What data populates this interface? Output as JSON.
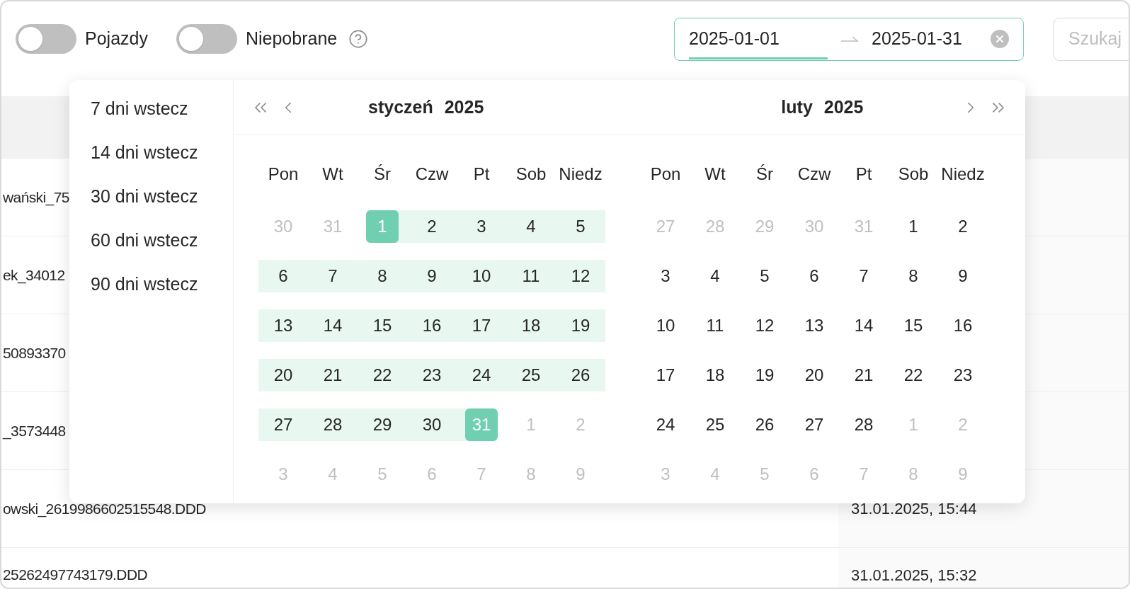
{
  "toggles": [
    {
      "label": "Pojazdy",
      "on": false,
      "help": false
    },
    {
      "label": "Niepobrane",
      "on": false,
      "help": true
    }
  ],
  "date_range": {
    "start": "2025-01-01",
    "end": "2025-01-31",
    "start_active": true
  },
  "search": {
    "placeholder": "Szukaj"
  },
  "table": {
    "rows": [
      {
        "file": "wański_75"
      },
      {
        "file": "ek_34012"
      },
      {
        "file": "50893370"
      },
      {
        "file": "_3573448"
      },
      {
        "file": "owski_2619986602515548.DDD",
        "date": "31.01.2025, 15:44"
      },
      {
        "file": "25262497743179.DDD",
        "date": "31.01.2025, 15:32"
      }
    ]
  },
  "picker": {
    "presets": [
      "7 dni wstecz",
      "14 dni wstecz",
      "30 dni wstecz",
      "60 dni wstecz",
      "90 dni wstecz"
    ],
    "months": [
      {
        "month": "styczeń",
        "year": "2025",
        "weekdays": [
          "Pon",
          "Wt",
          "Śr",
          "Czw",
          "Pt",
          "Sob",
          "Niedz"
        ],
        "weeks": [
          [
            {
              "d": "30",
              "muted": true,
              "in_range": false,
              "selected": false
            },
            {
              "d": "31",
              "muted": true,
              "in_range": false,
              "selected": false
            },
            {
              "d": "1",
              "muted": false,
              "in_range": true,
              "selected": true
            },
            {
              "d": "2",
              "muted": false,
              "in_range": true,
              "selected": false
            },
            {
              "d": "3",
              "muted": false,
              "in_range": true,
              "selected": false
            },
            {
              "d": "4",
              "muted": false,
              "in_range": true,
              "selected": false
            },
            {
              "d": "5",
              "muted": false,
              "in_range": true,
              "selected": false
            }
          ],
          [
            {
              "d": "6",
              "muted": false,
              "in_range": true,
              "selected": false
            },
            {
              "d": "7",
              "muted": false,
              "in_range": true,
              "selected": false
            },
            {
              "d": "8",
              "muted": false,
              "in_range": true,
              "selected": false
            },
            {
              "d": "9",
              "muted": false,
              "in_range": true,
              "selected": false
            },
            {
              "d": "10",
              "muted": false,
              "in_range": true,
              "selected": false
            },
            {
              "d": "11",
              "muted": false,
              "in_range": true,
              "selected": false
            },
            {
              "d": "12",
              "muted": false,
              "in_range": true,
              "selected": false
            }
          ],
          [
            {
              "d": "13",
              "muted": false,
              "in_range": true,
              "selected": false
            },
            {
              "d": "14",
              "muted": false,
              "in_range": true,
              "selected": false
            },
            {
              "d": "15",
              "muted": false,
              "in_range": true,
              "selected": false
            },
            {
              "d": "16",
              "muted": false,
              "in_range": true,
              "selected": false
            },
            {
              "d": "17",
              "muted": false,
              "in_range": true,
              "selected": false
            },
            {
              "d": "18",
              "muted": false,
              "in_range": true,
              "selected": false
            },
            {
              "d": "19",
              "muted": false,
              "in_range": true,
              "selected": false
            }
          ],
          [
            {
              "d": "20",
              "muted": false,
              "in_range": true,
              "selected": false
            },
            {
              "d": "21",
              "muted": false,
              "in_range": true,
              "selected": false
            },
            {
              "d": "22",
              "muted": false,
              "in_range": true,
              "selected": false
            },
            {
              "d": "23",
              "muted": false,
              "in_range": true,
              "selected": false
            },
            {
              "d": "24",
              "muted": false,
              "in_range": true,
              "selected": false
            },
            {
              "d": "25",
              "muted": false,
              "in_range": true,
              "selected": false
            },
            {
              "d": "26",
              "muted": false,
              "in_range": true,
              "selected": false
            }
          ],
          [
            {
              "d": "27",
              "muted": false,
              "in_range": true,
              "selected": false
            },
            {
              "d": "28",
              "muted": false,
              "in_range": true,
              "selected": false
            },
            {
              "d": "29",
              "muted": false,
              "in_range": true,
              "selected": false
            },
            {
              "d": "30",
              "muted": false,
              "in_range": true,
              "selected": false
            },
            {
              "d": "31",
              "muted": false,
              "in_range": true,
              "selected": true
            },
            {
              "d": "1",
              "muted": true,
              "in_range": false,
              "selected": false
            },
            {
              "d": "2",
              "muted": true,
              "in_range": false,
              "selected": false
            }
          ],
          [
            {
              "d": "3",
              "muted": true,
              "in_range": false,
              "selected": false
            },
            {
              "d": "4",
              "muted": true,
              "in_range": false,
              "selected": false
            },
            {
              "d": "5",
              "muted": true,
              "in_range": false,
              "selected": false
            },
            {
              "d": "6",
              "muted": true,
              "in_range": false,
              "selected": false
            },
            {
              "d": "7",
              "muted": true,
              "in_range": false,
              "selected": false
            },
            {
              "d": "8",
              "muted": true,
              "in_range": false,
              "selected": false
            },
            {
              "d": "9",
              "muted": true,
              "in_range": false,
              "selected": false
            }
          ]
        ]
      },
      {
        "month": "luty",
        "year": "2025",
        "weekdays": [
          "Pon",
          "Wt",
          "Śr",
          "Czw",
          "Pt",
          "Sob",
          "Niedz"
        ],
        "weeks": [
          [
            {
              "d": "27",
              "muted": true,
              "in_range": false,
              "selected": false
            },
            {
              "d": "28",
              "muted": true,
              "in_range": false,
              "selected": false
            },
            {
              "d": "29",
              "muted": true,
              "in_range": false,
              "selected": false
            },
            {
              "d": "30",
              "muted": true,
              "in_range": false,
              "selected": false
            },
            {
              "d": "31",
              "muted": true,
              "in_range": false,
              "selected": false
            },
            {
              "d": "1",
              "muted": false,
              "in_range": false,
              "selected": false
            },
            {
              "d": "2",
              "muted": false,
              "in_range": false,
              "selected": false
            }
          ],
          [
            {
              "d": "3",
              "muted": false,
              "in_range": false,
              "selected": false
            },
            {
              "d": "4",
              "muted": false,
              "in_range": false,
              "selected": false
            },
            {
              "d": "5",
              "muted": false,
              "in_range": false,
              "selected": false
            },
            {
              "d": "6",
              "muted": false,
              "in_range": false,
              "selected": false
            },
            {
              "d": "7",
              "muted": false,
              "in_range": false,
              "selected": false
            },
            {
              "d": "8",
              "muted": false,
              "in_range": false,
              "selected": false
            },
            {
              "d": "9",
              "muted": false,
              "in_range": false,
              "selected": false
            }
          ],
          [
            {
              "d": "10",
              "muted": false,
              "in_range": false,
              "selected": false
            },
            {
              "d": "11",
              "muted": false,
              "in_range": false,
              "selected": false
            },
            {
              "d": "12",
              "muted": false,
              "in_range": false,
              "selected": false
            },
            {
              "d": "13",
              "muted": false,
              "in_range": false,
              "selected": false
            },
            {
              "d": "14",
              "muted": false,
              "in_range": false,
              "selected": false
            },
            {
              "d": "15",
              "muted": false,
              "in_range": false,
              "selected": false
            },
            {
              "d": "16",
              "muted": false,
              "in_range": false,
              "selected": false
            }
          ],
          [
            {
              "d": "17",
              "muted": false,
              "in_range": false,
              "selected": false
            },
            {
              "d": "18",
              "muted": false,
              "in_range": false,
              "selected": false
            },
            {
              "d": "19",
              "muted": false,
              "in_range": false,
              "selected": false
            },
            {
              "d": "20",
              "muted": false,
              "in_range": false,
              "selected": false
            },
            {
              "d": "21",
              "muted": false,
              "in_range": false,
              "selected": false
            },
            {
              "d": "22",
              "muted": false,
              "in_range": false,
              "selected": false
            },
            {
              "d": "23",
              "muted": false,
              "in_range": false,
              "selected": false
            }
          ],
          [
            {
              "d": "24",
              "muted": false,
              "in_range": false,
              "selected": false
            },
            {
              "d": "25",
              "muted": false,
              "in_range": false,
              "selected": false
            },
            {
              "d": "26",
              "muted": false,
              "in_range": false,
              "selected": false
            },
            {
              "d": "27",
              "muted": false,
              "in_range": false,
              "selected": false
            },
            {
              "d": "28",
              "muted": false,
              "in_range": false,
              "selected": false
            },
            {
              "d": "1",
              "muted": true,
              "in_range": false,
              "selected": false
            },
            {
              "d": "2",
              "muted": true,
              "in_range": false,
              "selected": false
            }
          ],
          [
            {
              "d": "3",
              "muted": true,
              "in_range": false,
              "selected": false
            },
            {
              "d": "4",
              "muted": true,
              "in_range": false,
              "selected": false
            },
            {
              "d": "5",
              "muted": true,
              "in_range": false,
              "selected": false
            },
            {
              "d": "6",
              "muted": true,
              "in_range": false,
              "selected": false
            },
            {
              "d": "7",
              "muted": true,
              "in_range": false,
              "selected": false
            },
            {
              "d": "8",
              "muted": true,
              "in_range": false,
              "selected": false
            },
            {
              "d": "9",
              "muted": true,
              "in_range": false,
              "selected": false
            }
          ]
        ]
      }
    ]
  }
}
